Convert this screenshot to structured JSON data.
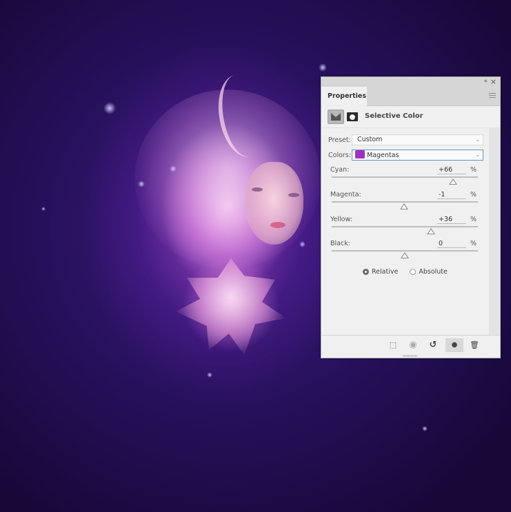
{
  "panel": {
    "tab_label": "Properties",
    "adjustment_title": "Selective Color",
    "preset": {
      "label": "Preset:",
      "value": "Custom"
    },
    "colors": {
      "label": "Colors:",
      "value": "Magentas",
      "swatch_color": "#a030c0"
    },
    "sliders": [
      {
        "label": "Cyan:",
        "value": "+66",
        "unit": "%",
        "percent": 66
      },
      {
        "label": "Magenta:",
        "value": "-1",
        "unit": "%",
        "percent": -1
      },
      {
        "label": "Yellow:",
        "value": "+36",
        "unit": "%",
        "percent": 36
      },
      {
        "label": "Black:",
        "value": "0",
        "unit": "%",
        "percent": 0
      }
    ],
    "method": {
      "options": [
        "Relative",
        "Absolute"
      ],
      "selected": "Relative"
    },
    "icons": {
      "collapse": "«",
      "close": "×",
      "clip": "⬚",
      "view_previous": "◉",
      "reset": "↺",
      "visibility": "●",
      "delete": "🗑"
    }
  }
}
